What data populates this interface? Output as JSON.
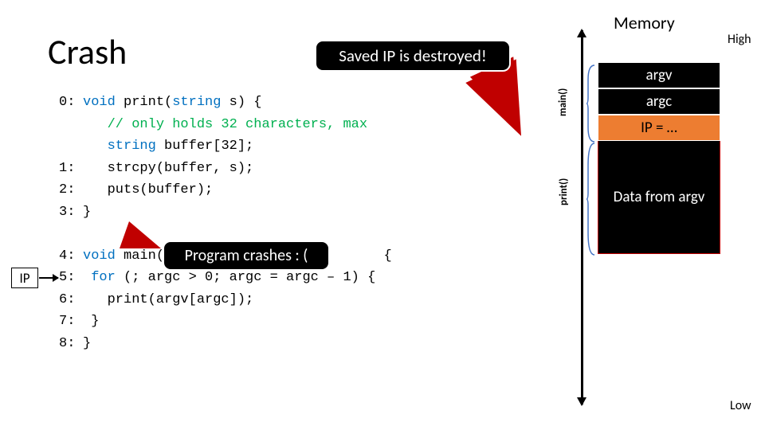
{
  "title": "Crash",
  "memory_title": "Memory",
  "callouts": {
    "top": "Saved IP is destroyed!",
    "mid": "Program crashes : ("
  },
  "ip_label": "IP",
  "axis": {
    "high": "High",
    "low": "Low"
  },
  "brace_labels": {
    "main": "main()",
    "print": "print()"
  },
  "code": {
    "l0n": "0:",
    "l0a": "void",
    "l0b": " print(",
    "l0c": "string",
    "l0d": " s) {",
    "l0e": "// only holds 32 characters, max",
    "l0f": "string",
    "l0g": " buffer[32];",
    "l1n": "1:",
    "l1": "strcpy(buffer, s);",
    "l2n": "2:",
    "l2": "puts(buffer);",
    "l3n": "3:",
    "l3": "}",
    "l4n": "4:",
    "l4a": "void",
    "l4b": " main(in",
    "l4c": " {",
    "l5n": "5:",
    "l5a": "for",
    "l5b": " (; argc > 0; argc = argc – 1) {",
    "l6n": "6:",
    "l6": "print(argv[argc]);",
    "l7n": "7:",
    "l7": "}",
    "l8n": "8:",
    "l8": "}"
  },
  "stack": {
    "argv": "argv",
    "argc": "argc",
    "ip": "IP = …",
    "data": "Data from argv"
  }
}
